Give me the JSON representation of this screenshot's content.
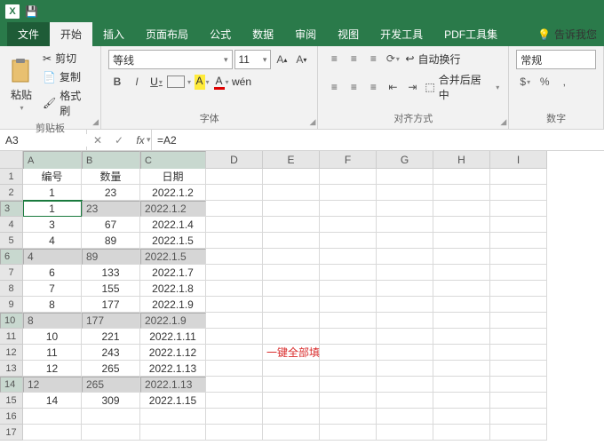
{
  "titlebar": {
    "save_icon": "💾"
  },
  "tabs": {
    "file": "文件",
    "home": "开始",
    "insert": "插入",
    "layout": "页面布局",
    "formulas": "公式",
    "data": "数据",
    "review": "审阅",
    "view": "视图",
    "dev": "开发工具",
    "pdf": "PDF工具集",
    "tell": "告诉我您"
  },
  "ribbon": {
    "clipboard": {
      "paste": "粘贴",
      "cut": "剪切",
      "copy": "复制",
      "painter": "格式刷",
      "label": "剪贴板"
    },
    "font": {
      "name": "等线",
      "size": "11",
      "label": "字体",
      "bold": "B",
      "italic": "I",
      "underline": "U"
    },
    "align": {
      "wrap": "自动换行",
      "merge": "合并后居中",
      "label": "对齐方式"
    },
    "number": {
      "format": "常规",
      "label": "数字"
    }
  },
  "formula": {
    "ref": "A3",
    "fx": "=A2"
  },
  "cols": [
    "A",
    "B",
    "C",
    "D",
    "E",
    "F",
    "G",
    "H",
    "I"
  ],
  "headers": {
    "c1": "编号",
    "c2": "数量",
    "c3": "日期"
  },
  "data": [
    {
      "n": "1",
      "q": "23",
      "d": "2022.1.2"
    },
    {
      "n": "1",
      "q": "23",
      "d": "2022.1.2",
      "sel": true,
      "outA": true
    },
    {
      "n": "3",
      "q": "67",
      "d": "2022.1.4"
    },
    {
      "n": "4",
      "q": "89",
      "d": "2022.1.5"
    },
    {
      "n": "4",
      "q": "89",
      "d": "2022.1.5",
      "sel": true
    },
    {
      "n": "6",
      "q": "133",
      "d": "2022.1.7"
    },
    {
      "n": "7",
      "q": "155",
      "d": "2022.1.8"
    },
    {
      "n": "8",
      "q": "177",
      "d": "2022.1.9"
    },
    {
      "n": "8",
      "q": "177",
      "d": "2022.1.9",
      "sel": true
    },
    {
      "n": "10",
      "q": "221",
      "d": "2022.1.11"
    },
    {
      "n": "11",
      "q": "243",
      "d": "2022.1.12",
      "anno": "一键全部填充"
    },
    {
      "n": "12",
      "q": "265",
      "d": "2022.1.13"
    },
    {
      "n": "12",
      "q": "265",
      "d": "2022.1.13",
      "sel": true
    },
    {
      "n": "14",
      "q": "309",
      "d": "2022.1.15"
    }
  ]
}
